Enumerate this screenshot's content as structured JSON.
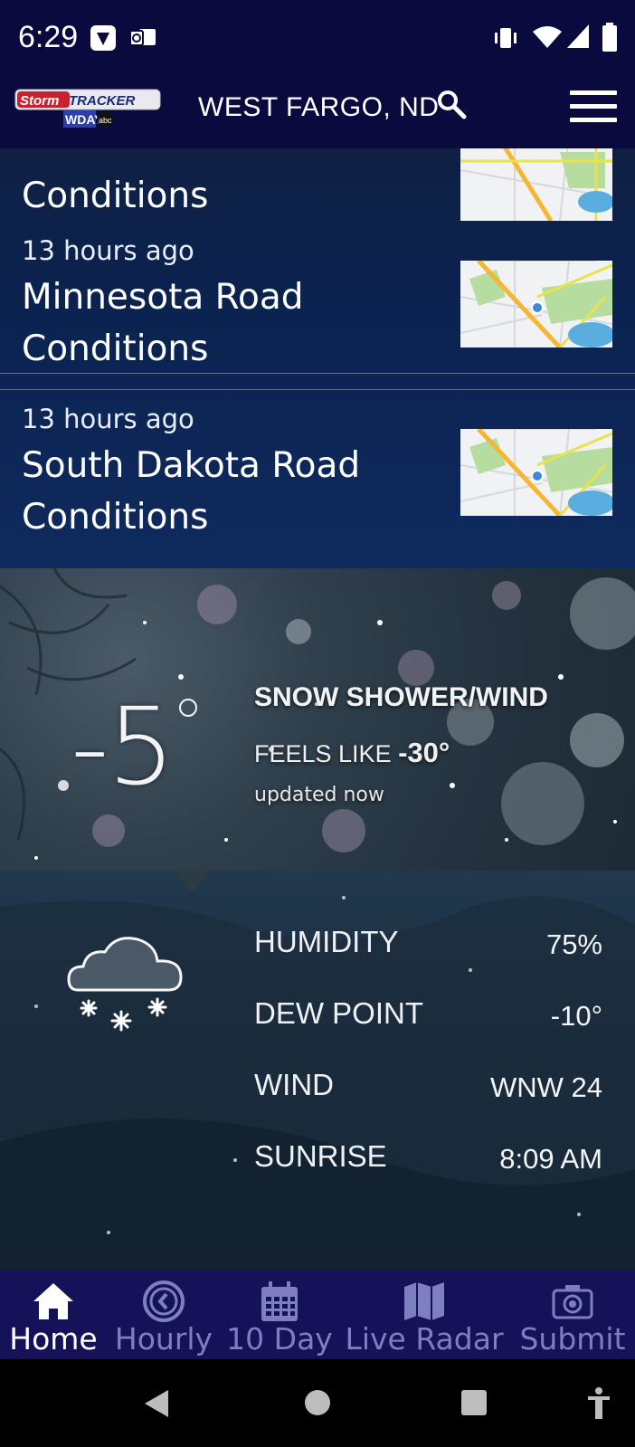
{
  "status_bar": {
    "time": "6:29"
  },
  "header": {
    "location": "WEST FARGO, ND",
    "logo_text": "StormTRACKER",
    "logo_sub": "WDAY"
  },
  "news": [
    {
      "time": "",
      "title": "Conditions"
    },
    {
      "time": "13 hours ago",
      "title": "Minnesota Road Conditions"
    },
    {
      "time": "13 hours ago",
      "title": "South Dakota Road Conditions"
    }
  ],
  "current": {
    "temperature": "-5",
    "condition": "SNOW SHOWER/WIND",
    "feels_like_label": "FEELS LIKE",
    "feels_like_value": "-30°",
    "updated": "updated now"
  },
  "details": [
    {
      "label": "HUMIDITY",
      "value": "75%"
    },
    {
      "label": "DEW POINT",
      "value": "-10°"
    },
    {
      "label": "WIND",
      "value": "WNW 24"
    },
    {
      "label": "SUNRISE",
      "value": "8:09 AM"
    }
  ],
  "tabs": [
    {
      "label": "Home",
      "icon": "home-icon",
      "active": true
    },
    {
      "label": "Hourly",
      "icon": "clock-icon",
      "active": false
    },
    {
      "label": "10 Day",
      "icon": "calendar-icon",
      "active": false
    },
    {
      "label": "Live Radar",
      "icon": "map-icon",
      "active": false
    },
    {
      "label": "Submit",
      "icon": "camera-icon",
      "active": false
    }
  ],
  "colors": {
    "bar_bg": "#0b0a3e",
    "tab_bg": "#16125a",
    "tab_inactive": "#7d7fc0"
  }
}
